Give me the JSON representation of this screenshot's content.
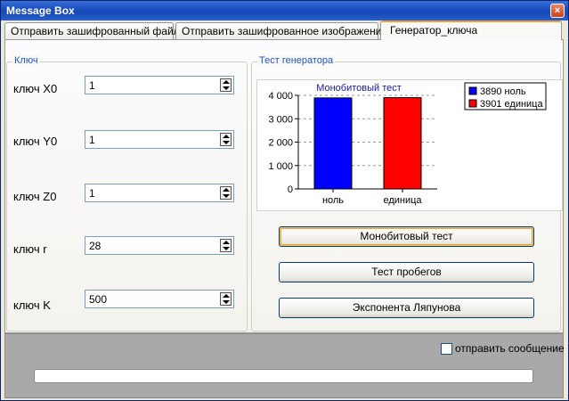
{
  "window": {
    "title": "Message Box",
    "close_glyph": "×"
  },
  "tabs": [
    {
      "label": "Отправить зашифрованный файл",
      "active": false
    },
    {
      "label": "Отправить зашифрованное изображение",
      "active": false
    },
    {
      "label": "Генератор_ключа",
      "active": true
    }
  ],
  "key_group": {
    "title": "Ключ",
    "fields": [
      {
        "label": "ключ X0",
        "value": "1"
      },
      {
        "label": "ключ Y0",
        "value": "1"
      },
      {
        "label": "ключ Z0",
        "value": "1"
      },
      {
        "label": "ключ r",
        "value": "28"
      },
      {
        "label": "ключ K",
        "value": "500"
      }
    ]
  },
  "test_group": {
    "title": "Тест генератора"
  },
  "buttons": {
    "monobit": "Монобитовый тест",
    "runs": "Тест пробегов",
    "lyapunov": "Экспонента Ляпунова"
  },
  "bottom": {
    "send_message_label": "отправить сообщение",
    "send_message_checked": false,
    "progress_fraction": 0
  },
  "chart_data": {
    "type": "bar",
    "title": "Монобитовый тест",
    "categories": [
      "ноль",
      "единица"
    ],
    "values": [
      3890,
      3901
    ],
    "colors": [
      "#0000ff",
      "#ff0000"
    ],
    "legend": [
      {
        "label": "3890 ноль",
        "color": "#0000ff"
      },
      {
        "label": "3901 единица",
        "color": "#ff0000"
      }
    ],
    "ylim": [
      0,
      4000
    ],
    "yticks": [
      "0",
      "1 000",
      "2 000",
      "3 000",
      "4 000"
    ],
    "ytick_values": [
      0,
      1000,
      2000,
      3000,
      4000
    ],
    "grid": true,
    "legend_position": "right"
  }
}
